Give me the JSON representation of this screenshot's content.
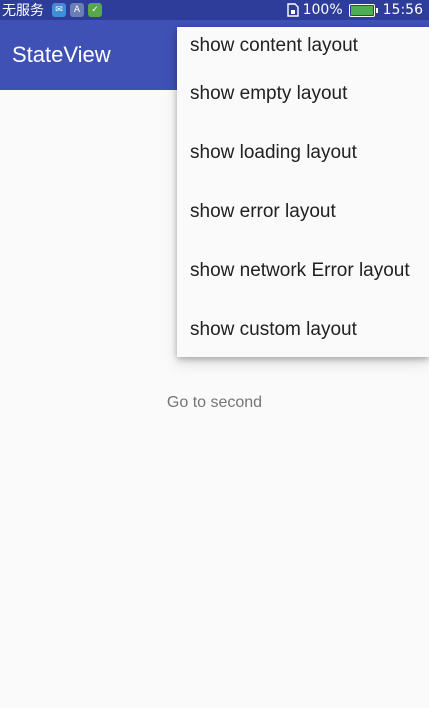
{
  "status_bar": {
    "carrier": "无服务",
    "app_icons": [
      "message-icon",
      "a-app-icon",
      "green-app-icon"
    ],
    "battery_percent": "100%",
    "battery_level": 1.0,
    "time": "15:56"
  },
  "app_bar": {
    "title": "StateView"
  },
  "main": {
    "go_to_second": "Go to second"
  },
  "menu": {
    "items": [
      {
        "label": "show content layout"
      },
      {
        "label": "show empty layout"
      },
      {
        "label": "show loading layout"
      },
      {
        "label": "show error layout"
      },
      {
        "label": "show network Error layout"
      },
      {
        "label": "show custom layout"
      }
    ]
  },
  "colors": {
    "status_bar": "#2e3d9a",
    "app_bar": "#3f51b5",
    "background": "#fafafa",
    "menu_text": "#212121",
    "secondary_text": "#757575"
  }
}
